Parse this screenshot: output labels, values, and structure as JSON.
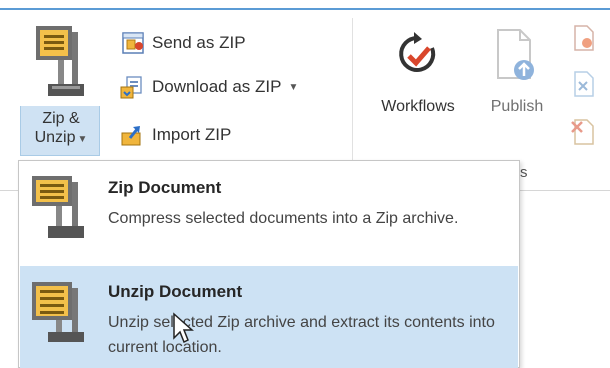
{
  "ribbon": {
    "zip_unzip": {
      "label_line1": "Zip &",
      "label_line2": "Unzip",
      "icon": "compress-clamp-icon"
    },
    "send_as_zip": {
      "label": "Send as ZIP",
      "icon": "send-zip-icon"
    },
    "download_as_zip": {
      "label": "Download as ZIP",
      "icon": "download-zip-icon"
    },
    "import_zip": {
      "label": "Import ZIP",
      "icon": "import-zip-icon"
    },
    "workflows": {
      "label": "Workflows",
      "icon": "workflow-icon"
    },
    "publish": {
      "label": "Publish",
      "icon": "publish-icon"
    },
    "group_label_fragment": "s"
  },
  "menu": {
    "items": [
      {
        "title": "Zip Document",
        "description": "Compress selected documents into a Zip archive.",
        "icon": "zip-document-icon"
      },
      {
        "title": "Unzip Document",
        "description": "Unzip selected Zip archive and extract its contents into current location.",
        "icon": "unzip-document-icon"
      }
    ]
  },
  "colors": {
    "accent": "#5b9bd5",
    "hover": "#cde2f4",
    "workflow_red": "#d9462c"
  }
}
